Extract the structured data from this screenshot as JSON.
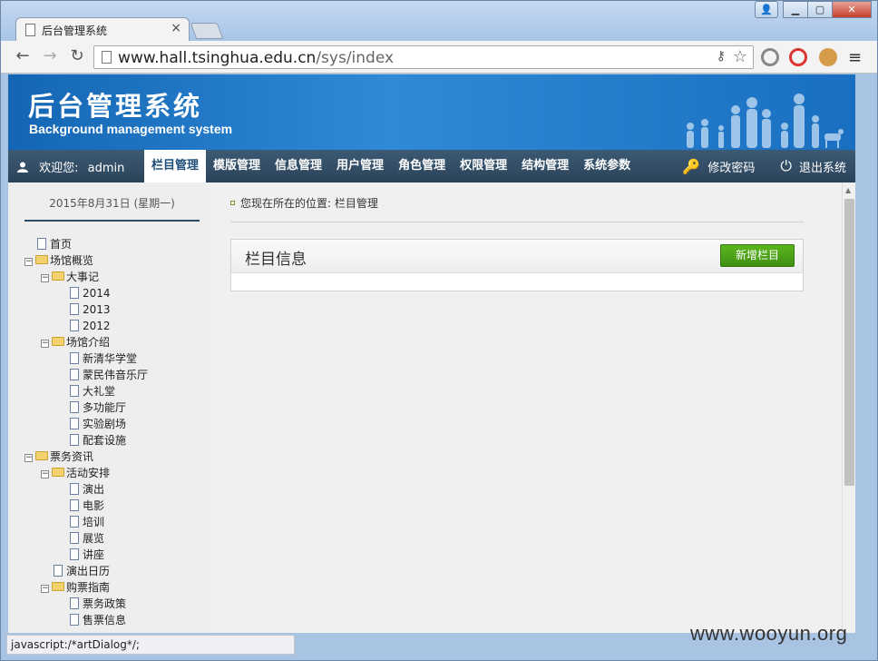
{
  "browser": {
    "tab_title": "后台管理系统",
    "tab_close": "×",
    "url_host": "www.hall.tsinghua.edu.cn",
    "url_path": "/sys/index",
    "status_text": "javascript:/*artDialog*/;",
    "win_minimize": "▁",
    "win_maximize": "▢",
    "win_close": "✕",
    "win_user": "👤"
  },
  "header": {
    "title": "后台管理系统",
    "subtitle": "Background management system"
  },
  "nav": {
    "welcome_label": "欢迎您:",
    "username": "admin",
    "items": [
      "栏目管理",
      "模版管理",
      "信息管理",
      "用户管理",
      "角色管理",
      "权限管理",
      "结构管理",
      "系统参数"
    ],
    "active_index": 0,
    "change_password": "修改密码",
    "logout": "退出系统"
  },
  "sidebar": {
    "date": "2015年8月31日 (星期一)",
    "tree": [
      {
        "label": "首页",
        "type": "file",
        "level": 0,
        "toggle": ""
      },
      {
        "label": "场馆概览",
        "type": "folder",
        "level": 0,
        "toggle": "−"
      },
      {
        "label": "大事记",
        "type": "folder",
        "level": 1,
        "toggle": "−"
      },
      {
        "label": "2014",
        "type": "file",
        "level": 2,
        "toggle": ""
      },
      {
        "label": "2013",
        "type": "file",
        "level": 2,
        "toggle": ""
      },
      {
        "label": "2012",
        "type": "file",
        "level": 2,
        "toggle": ""
      },
      {
        "label": "场馆介绍",
        "type": "folder",
        "level": 1,
        "toggle": "−"
      },
      {
        "label": "新清华学堂",
        "type": "file",
        "level": 2,
        "toggle": ""
      },
      {
        "label": "蒙民伟音乐厅",
        "type": "file",
        "level": 2,
        "toggle": ""
      },
      {
        "label": "大礼堂",
        "type": "file",
        "level": 2,
        "toggle": ""
      },
      {
        "label": "多功能厅",
        "type": "file",
        "level": 2,
        "toggle": ""
      },
      {
        "label": "实验剧场",
        "type": "file",
        "level": 2,
        "toggle": ""
      },
      {
        "label": "配套设施",
        "type": "file",
        "level": 2,
        "toggle": ""
      },
      {
        "label": "票务资讯",
        "type": "folder",
        "level": 0,
        "toggle": "−"
      },
      {
        "label": "活动安排",
        "type": "folder",
        "level": 1,
        "toggle": "−"
      },
      {
        "label": "演出",
        "type": "file",
        "level": 2,
        "toggle": ""
      },
      {
        "label": "电影",
        "type": "file",
        "level": 2,
        "toggle": ""
      },
      {
        "label": "培训",
        "type": "file",
        "level": 2,
        "toggle": ""
      },
      {
        "label": "展览",
        "type": "file",
        "level": 2,
        "toggle": ""
      },
      {
        "label": "讲座",
        "type": "file",
        "level": 2,
        "toggle": ""
      },
      {
        "label": "演出日历",
        "type": "file",
        "level": 1,
        "toggle": ""
      },
      {
        "label": "购票指南",
        "type": "folder",
        "level": 1,
        "toggle": "−"
      },
      {
        "label": "票务政策",
        "type": "file",
        "level": 2,
        "toggle": ""
      },
      {
        "label": "售票信息",
        "type": "file",
        "level": 2,
        "toggle": ""
      }
    ]
  },
  "content": {
    "breadcrumb": "您现在所在的位置: 栏目管理",
    "panel_title": "栏目信息",
    "add_button": "新增栏目"
  },
  "watermark": "www.wooyun.org",
  "colors": {
    "banner_blue": "#1a6fc0",
    "nav_dark": "#2b4359",
    "add_green": "#4ca118"
  },
  "icons": {
    "user": "user-icon",
    "key": "key-icon",
    "power": "power-icon",
    "folder": "folder-icon",
    "file": "file-icon"
  }
}
